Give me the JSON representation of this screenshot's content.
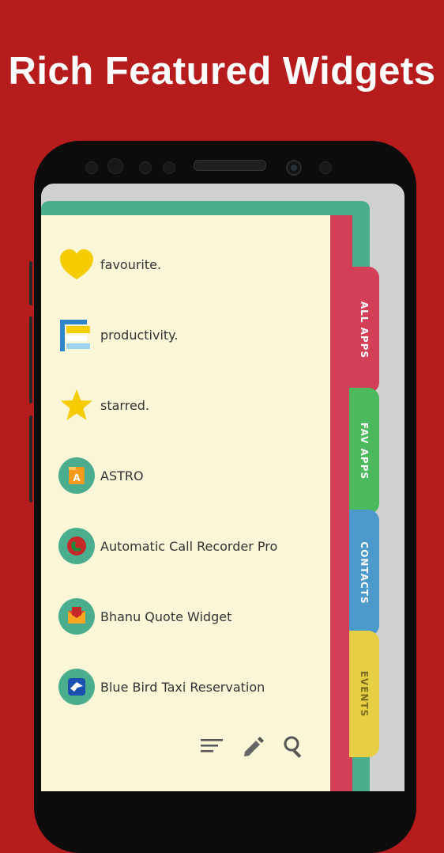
{
  "headline": "Rich Featured Widgets",
  "tabs": [
    {
      "label": "ALL APPS",
      "color": "#d23f56"
    },
    {
      "label": "FAV APPS",
      "color": "#4cb95d"
    },
    {
      "label": "CONTACTS",
      "color": "#4c9acc"
    },
    {
      "label": "EVENTS",
      "color": "#e7cf45"
    }
  ],
  "items": [
    {
      "label": "favourite.",
      "icon": "heart-icon"
    },
    {
      "label": "productivity.",
      "icon": "productivity-icon"
    },
    {
      "label": "starred.",
      "icon": "star-icon"
    },
    {
      "label": "ASTRO",
      "icon": "astro-app-icon"
    },
    {
      "label": "Automatic Call Recorder Pro",
      "icon": "call-recorder-app-icon"
    },
    {
      "label": "Bhanu Quote Widget",
      "icon": "quote-widget-app-icon"
    },
    {
      "label": "Blue Bird Taxi Reservation",
      "icon": "taxi-app-icon"
    }
  ],
  "toolbar": [
    "sort-icon",
    "edit-icon",
    "search-icon"
  ],
  "colors": {
    "background": "#b71c1c",
    "paper": "#faf6d7",
    "accent": "#4aae8e"
  }
}
